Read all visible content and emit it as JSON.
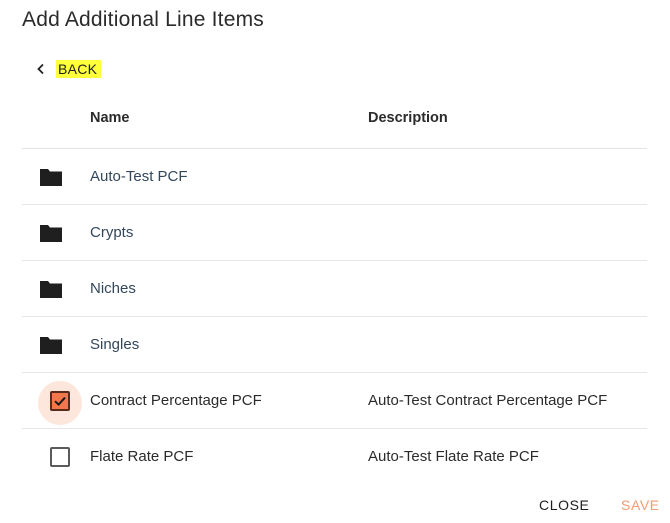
{
  "dialog": {
    "title": "Add Additional Line Items",
    "back_label": "BACK",
    "columns": {
      "name": "Name",
      "description": "Description"
    },
    "rows": [
      {
        "type": "folder",
        "name": "Auto-Test PCF",
        "description": ""
      },
      {
        "type": "folder",
        "name": "Crypts",
        "description": ""
      },
      {
        "type": "folder",
        "name": "Niches",
        "description": ""
      },
      {
        "type": "folder",
        "name": "Singles",
        "description": ""
      },
      {
        "type": "item",
        "checked": true,
        "name": "Contract Percentage PCF",
        "description": "Auto-Test Contract Percentage PCF"
      },
      {
        "type": "item",
        "checked": false,
        "name": "Flate Rate PCF",
        "description": "Auto-Test Flate Rate PCF"
      }
    ],
    "actions": {
      "close_label": "CLOSE",
      "save_label": "SAVE"
    }
  },
  "colors": {
    "accent": "#f2784b",
    "highlight": "#ffff3c",
    "folder_text": "#33475b"
  },
  "icons": {
    "back": "chevron-left-icon",
    "folder": "folder-icon",
    "checked": "checkbox-checked-icon",
    "unchecked": "checkbox-unchecked-icon"
  }
}
